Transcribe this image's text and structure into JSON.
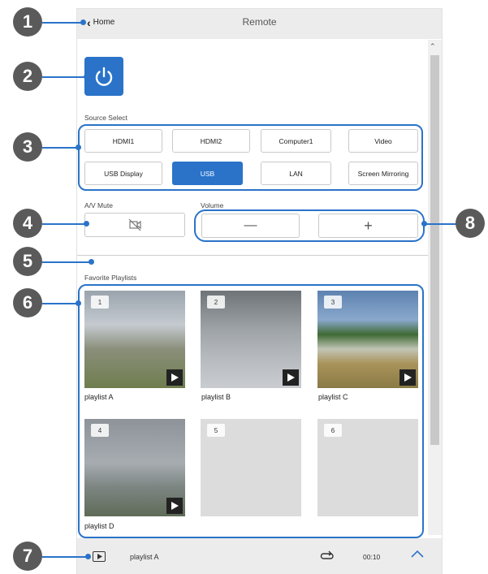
{
  "header": {
    "back_label": "Home",
    "title": "Remote"
  },
  "source_select": {
    "label": "Source Select",
    "buttons": [
      "HDMI1",
      "HDMI2",
      "Computer1",
      "Video",
      "USB Display",
      "USB",
      "LAN",
      "Screen Mirroring"
    ],
    "selected": "USB"
  },
  "av_mute": {
    "label": "A/V Mute",
    "icon": "av-mute-icon"
  },
  "volume": {
    "label": "Volume",
    "minus": "—",
    "plus": "+"
  },
  "favorites": {
    "label": "Favorite Playlists",
    "tiles": [
      {
        "number": "1",
        "name": "playlist A"
      },
      {
        "number": "2",
        "name": "playlist B"
      },
      {
        "number": "3",
        "name": "playlist C"
      },
      {
        "number": "4",
        "name": "playlist D"
      },
      {
        "number": "5",
        "name": ""
      },
      {
        "number": "6",
        "name": ""
      }
    ]
  },
  "now_playing": {
    "name": "playlist A",
    "time": "00:10"
  },
  "callouts": [
    "1",
    "2",
    "3",
    "4",
    "5",
    "6",
    "7",
    "8"
  ],
  "colors": {
    "accent": "#2a73c9",
    "callout": "#5a5a5a"
  }
}
